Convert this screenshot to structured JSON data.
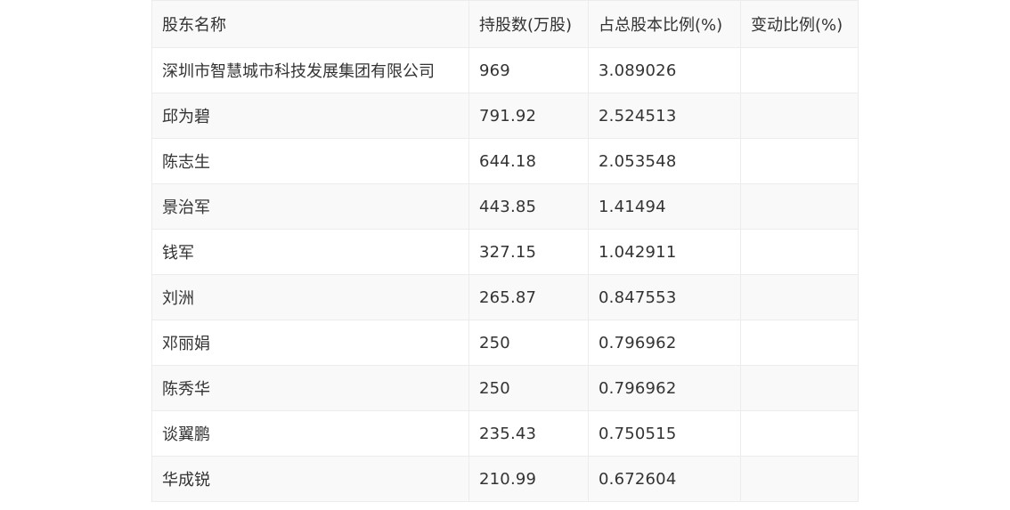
{
  "table": {
    "headers": [
      "股东名称",
      "持股数(万股)",
      "占总股本比例(%)",
      "变动比例(%)"
    ],
    "rows": [
      [
        "深圳市智慧城市科技发展集团有限公司",
        "969",
        "3.089026",
        ""
      ],
      [
        "邱为碧",
        "791.92",
        "2.524513",
        ""
      ],
      [
        "陈志生",
        "644.18",
        "2.053548",
        ""
      ],
      [
        "景治军",
        "443.85",
        "1.41494",
        ""
      ],
      [
        "钱军",
        "327.15",
        "1.042911",
        ""
      ],
      [
        "刘洲",
        "265.87",
        "0.847553",
        ""
      ],
      [
        "邓丽娟",
        "250",
        "0.796962",
        ""
      ],
      [
        "陈秀华",
        "250",
        "0.796962",
        ""
      ],
      [
        "谈翼鹏",
        "235.43",
        "0.750515",
        ""
      ],
      [
        "华成锐",
        "210.99",
        "0.672604",
        ""
      ]
    ]
  }
}
